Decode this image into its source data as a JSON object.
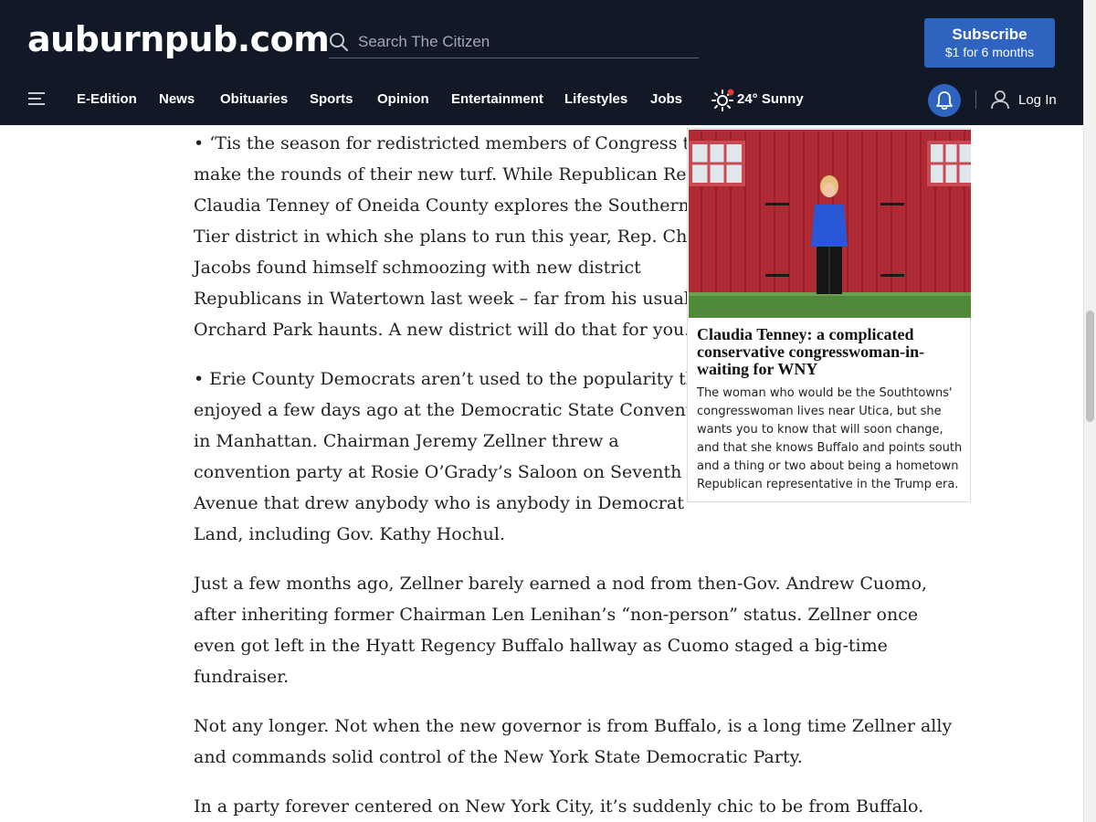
{
  "header": {
    "logo": "auburnpub.com",
    "search_placeholder": "Search The Citizen",
    "subscribe": {
      "title": "Subscribe",
      "offer": "$1 for 6 months"
    }
  },
  "nav": {
    "items": [
      "E-Edition",
      "News",
      "Obituaries",
      "Sports",
      "Opinion",
      "Entertainment",
      "Lifestyles",
      "Jobs"
    ],
    "weather": "24° Sunny",
    "login": "Log In"
  },
  "article": {
    "paragraphs": [
      [
        "• ‘Tis the season for redistricted members of Congress to",
        "make the rounds of their new turf. While Republican Rep.",
        "Claudia Tenney of Oneida County explores the Southern",
        "Tier district in which she plans to run this year, Rep. Chris",
        "Jacobs found himself schmoozing with new district",
        "Republicans in Watertown last week – far from his usual",
        "Orchard Park haunts. A new district will do that for you."
      ],
      [
        "• Erie County Democrats aren’t used to the popularity they",
        "enjoyed a few days ago at the Democratic State Convention",
        "in Manhattan. Chairman Jeremy Zellner threw a",
        "convention party at Rosie O’Grady’s Saloon on Seventh",
        "Avenue that drew anybody who is anybody in Democrat",
        "Land, including Gov. Kathy Hochul."
      ],
      [
        "Just a few months ago, Zellner barely earned a nod from then-Gov. Andrew Cuomo,",
        "after inheriting former Chairman Len Lenihan’s “non-person” status. Zellner once",
        "even got left in the Hyatt Regency Buffalo hallway as Cuomo staged a big-time",
        "fundraiser."
      ],
      [
        "Not any longer. Not when the new governor is from Buffalo, is a long time Zellner ally",
        "and commands solid control of the New York State Democratic Party."
      ],
      [
        "In a party forever centered on New York City, it’s suddenly chic to be from Buffalo."
      ]
    ]
  },
  "related": {
    "title": "Claudia Tenney: a complicated conservative congresswoman-in-waiting for WNY",
    "blurb": "The woman who would be the Southtowns' congresswoman lives near Utica, but she wants you to know that will soon change, and that she knows Buffalo and points south and a thing or two about being a hometown Republican representative in the Trump era."
  },
  "colors": {
    "header_bg": "#111826",
    "accent": "#2e63c0",
    "notification_dot": "#e53935"
  }
}
